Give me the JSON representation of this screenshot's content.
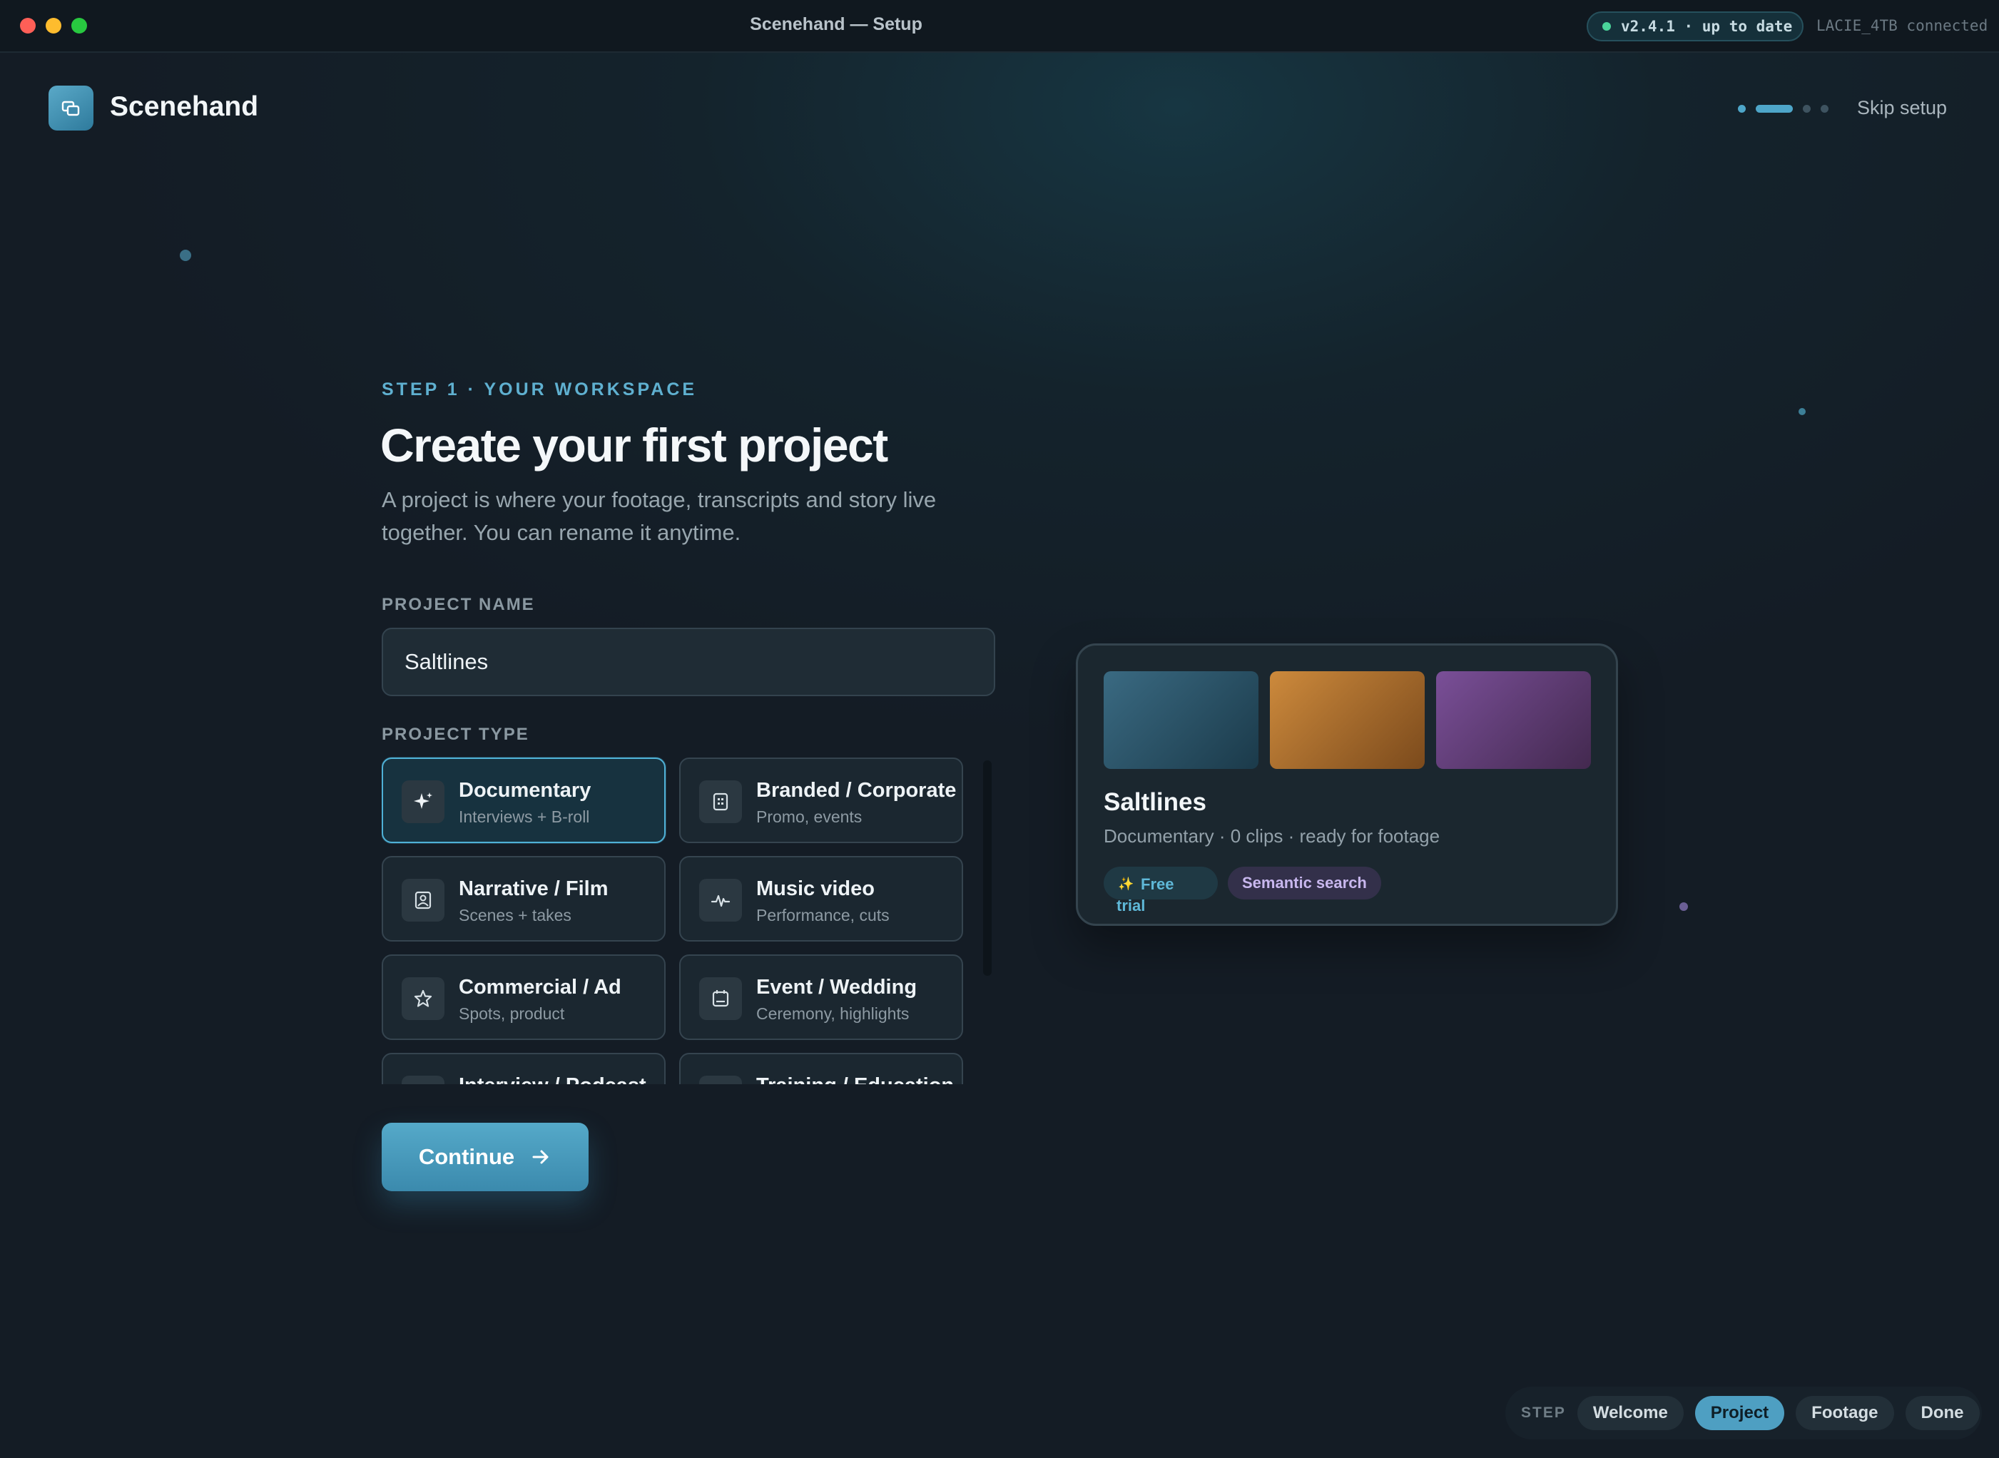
{
  "window": {
    "title": "Scenehand — Setup",
    "version_badge": "v2.4.1 · up to date",
    "drive_status": "LACIE_4TB connected"
  },
  "header": {
    "brand": "Scenehand",
    "skip_label": "Skip setup",
    "progress": {
      "total_steps": 4,
      "current_step": 2
    }
  },
  "main": {
    "eyebrow": "STEP 1 · YOUR WORKSPACE",
    "title": "Create your first project",
    "subtitle": "A project is where your footage, transcripts and story live together. You can rename it anytime.",
    "project_name_label": "PROJECT NAME",
    "project_name_value": "Saltlines",
    "project_type_label": "PROJECT TYPE",
    "project_types": [
      {
        "title": "Documentary",
        "subtitle": "Interviews + B-roll",
        "icon": "sparkle-icon",
        "selected": true
      },
      {
        "title": "Branded / Corporate",
        "subtitle": "Promo, events",
        "icon": "building-icon",
        "selected": false
      },
      {
        "title": "Narrative / Film",
        "subtitle": "Scenes + takes",
        "icon": "image-frame-icon",
        "selected": false
      },
      {
        "title": "Music video",
        "subtitle": "Performance, cuts",
        "icon": "waveform-icon",
        "selected": false
      },
      {
        "title": "Commercial / Ad",
        "subtitle": "Spots, product",
        "icon": "star-icon",
        "selected": false
      },
      {
        "title": "Event / Wedding",
        "subtitle": "Ceremony, highlights",
        "icon": "calendar-icon",
        "selected": false
      },
      {
        "title": "Interview / Podcast",
        "subtitle": "",
        "icon": "microphone-icon",
        "selected": false
      },
      {
        "title": "Training / Education",
        "subtitle": "",
        "icon": "book-icon",
        "selected": false
      }
    ],
    "continue_label": "Continue"
  },
  "preview": {
    "title": "Saltlines",
    "meta": "Documentary · 0 clips · ready for footage",
    "badge_trial": "Free trial",
    "badge_search": "Semantic search",
    "thumb_colors": [
      "#2f5a70",
      "#b87a35",
      "#6a4585"
    ]
  },
  "stepnav": {
    "label": "STEP",
    "steps": [
      "Welcome",
      "Project",
      "Footage",
      "Done"
    ],
    "active": "Project"
  },
  "colors": {
    "accent": "#4fb1d6",
    "background": "#141c25",
    "status_ok": "#4ad49a"
  }
}
